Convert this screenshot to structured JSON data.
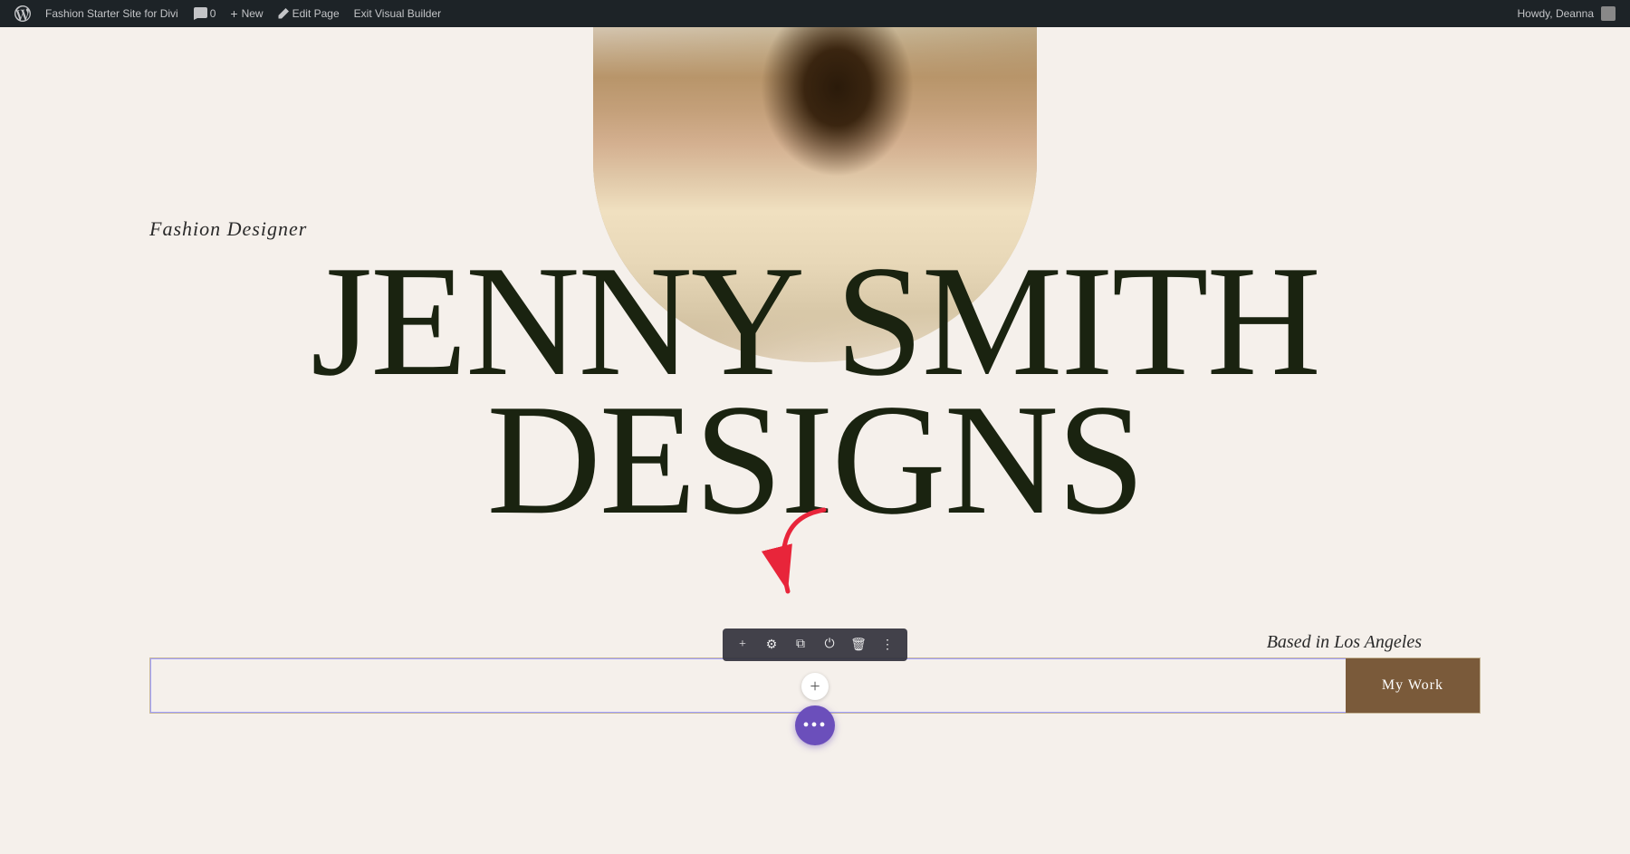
{
  "adminBar": {
    "siteName": "Fashion Starter Site for Divi",
    "commentCount": "0",
    "newLabel": "New",
    "editPageLabel": "Edit Page",
    "exitVisualBuilderLabel": "Exit Visual Builder",
    "howdyLabel": "Howdy, Deanna"
  },
  "hero": {
    "subheading": "Fashion Designer",
    "titleLine1": "JENNY SMITH",
    "titleLine2": "DESIGNS",
    "location": "Based in Los Angeles",
    "ctaButtonLabel": "My Work",
    "ctaInputPlaceholder": ""
  },
  "toolbar": {
    "addIcon": "+",
    "settingsIcon": "⚙",
    "duplicateIcon": "⧉",
    "disableIcon": "⏻",
    "deleteIcon": "🗑",
    "moreIcon": "⋮"
  },
  "colors": {
    "adminBarBg": "#1d2327",
    "heroBg": "#f5f0eb",
    "titleColor": "#1a2310",
    "ctaButtonBg": "#7a5a3a",
    "purpleBtn": "#6b4fbb",
    "toolbarBg": "rgba(50,50,60,0.92)"
  }
}
